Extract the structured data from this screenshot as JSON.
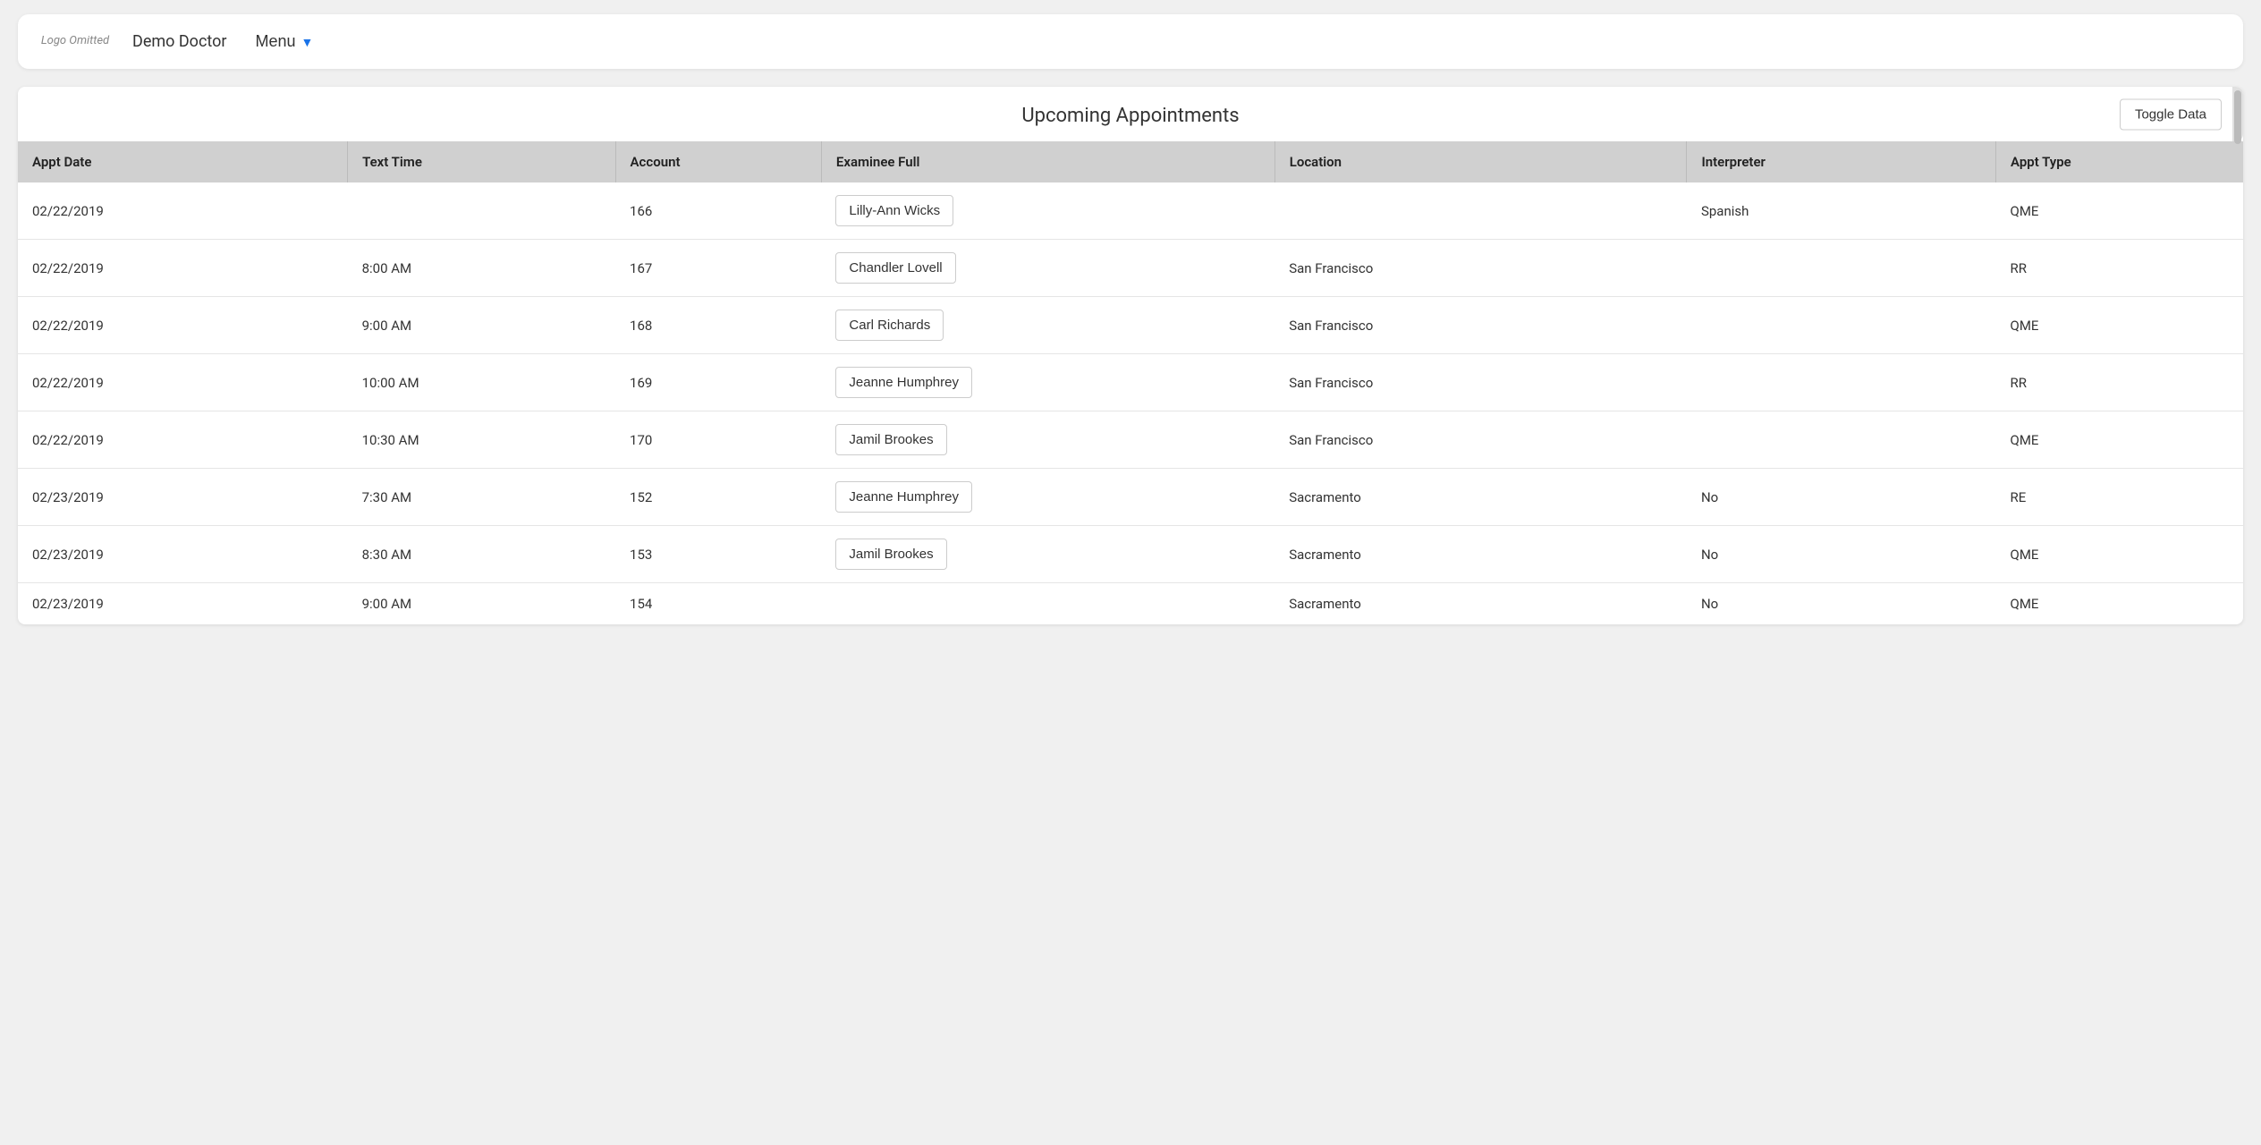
{
  "header": {
    "logo_text": "Logo\nOmitted",
    "doctor_name": "Demo Doctor",
    "menu_label": "Menu",
    "menu_chevron": "▼"
  },
  "card": {
    "title": "Upcoming Appointments",
    "toggle_btn_label": "Toggle Data"
  },
  "table": {
    "columns": [
      {
        "key": "appt_date",
        "label": "Appt Date"
      },
      {
        "key": "text_time",
        "label": "Text Time"
      },
      {
        "key": "account",
        "label": "Account"
      },
      {
        "key": "examinee_full",
        "label": "Examinee Full"
      },
      {
        "key": "location",
        "label": "Location"
      },
      {
        "key": "interpreter",
        "label": "Interpreter"
      },
      {
        "key": "appt_type",
        "label": "Appt Type"
      }
    ],
    "rows": [
      {
        "appt_date": "02/22/2019",
        "text_time": "",
        "account": "166",
        "examinee_full": "Lilly-Ann Wicks",
        "location": "",
        "interpreter": "Spanish",
        "appt_type": "QME"
      },
      {
        "appt_date": "02/22/2019",
        "text_time": "8:00 AM",
        "account": "167",
        "examinee_full": "Chandler Lovell",
        "location": "San Francisco",
        "interpreter": "",
        "appt_type": "RR"
      },
      {
        "appt_date": "02/22/2019",
        "text_time": "9:00 AM",
        "account": "168",
        "examinee_full": "Carl Richards",
        "location": "San Francisco",
        "interpreter": "",
        "appt_type": "QME"
      },
      {
        "appt_date": "02/22/2019",
        "text_time": "10:00 AM",
        "account": "169",
        "examinee_full": "Jeanne Humphrey",
        "location": "San Francisco",
        "interpreter": "",
        "appt_type": "RR"
      },
      {
        "appt_date": "02/22/2019",
        "text_time": "10:30 AM",
        "account": "170",
        "examinee_full": "Jamil Brookes",
        "location": "San Francisco",
        "interpreter": "",
        "appt_type": "QME"
      },
      {
        "appt_date": "02/23/2019",
        "text_time": "7:30 AM",
        "account": "152",
        "examinee_full": "Jeanne Humphrey",
        "location": "Sacramento",
        "interpreter": "No",
        "appt_type": "RE"
      },
      {
        "appt_date": "02/23/2019",
        "text_time": "8:30 AM",
        "account": "153",
        "examinee_full": "Jamil Brookes",
        "location": "Sacramento",
        "interpreter": "No",
        "appt_type": "QME"
      },
      {
        "appt_date": "02/23/2019",
        "text_time": "9:00 AM",
        "account": "154",
        "examinee_full": "",
        "location": "Sacramento",
        "interpreter": "No",
        "appt_type": "QME"
      }
    ]
  }
}
